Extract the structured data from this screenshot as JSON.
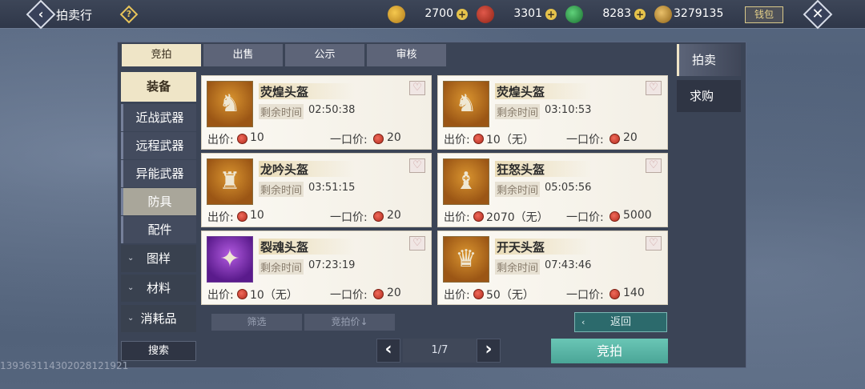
{
  "window": {
    "title": "拍卖行"
  },
  "topbar": {
    "back_icon": "‹",
    "help_icon": "?",
    "currencies": [
      {
        "name": "gold-ingot",
        "value": "2700",
        "color": "#e2a72f"
      },
      {
        "name": "red-coin",
        "value": "3301",
        "color": "#c2462e"
      },
      {
        "name": "jade-coin",
        "value": "8283",
        "color": "#2d9a47"
      },
      {
        "name": "silver-feather",
        "value": "3279135",
        "color": "#c89a3a"
      }
    ],
    "wallet_label": "钱包",
    "close_icon": "✕"
  },
  "tabs": [
    {
      "label": "竞拍",
      "active": true
    },
    {
      "label": "出售",
      "active": false
    },
    {
      "label": "公示",
      "active": false
    },
    {
      "label": "审核",
      "active": false
    }
  ],
  "categories": [
    {
      "label": "装备",
      "kind": "main-active"
    },
    {
      "label": "近战武器",
      "kind": "sub"
    },
    {
      "label": "远程武器",
      "kind": "sub"
    },
    {
      "label": "异能武器",
      "kind": "sub"
    },
    {
      "label": "防具",
      "kind": "sub-active"
    },
    {
      "label": "配件",
      "kind": "sub"
    },
    {
      "label": "图样",
      "kind": "group"
    },
    {
      "label": "材料",
      "kind": "group"
    },
    {
      "label": "消耗品",
      "kind": "group"
    }
  ],
  "listings": {
    "time_label": "剩余时间",
    "bid_label": "出价:",
    "buyout_label": "一口价:",
    "items": [
      {
        "name": "荧煌头盔",
        "time": "02:50:38",
        "bid": "10",
        "buyout": "20",
        "rarity": "orange",
        "icon": "horned-helmet-icon"
      },
      {
        "name": "荧煌头盔",
        "time": "03:10:53",
        "bid": "10（无）",
        "buyout": "20",
        "rarity": "orange",
        "icon": "horned-helmet-icon"
      },
      {
        "name": "龙吟头盔",
        "time": "03:51:15",
        "bid": "10",
        "buyout": "20",
        "rarity": "orange",
        "icon": "dragon-helmet-icon"
      },
      {
        "name": "狂怒头盔",
        "time": "05:05:56",
        "bid": "2070（无）",
        "buyout": "5000",
        "rarity": "orange",
        "icon": "fury-helmet-icon"
      },
      {
        "name": "裂魂头盔",
        "time": "07:23:19",
        "bid": "10（无）",
        "buyout": "20",
        "rarity": "purple",
        "icon": "spiked-helmet-icon"
      },
      {
        "name": "开天头盔",
        "time": "07:43:46",
        "bid": "50（无）",
        "buyout": "140",
        "rarity": "orange",
        "icon": "red-horned-helmet-icon"
      }
    ]
  },
  "filters": {
    "filter_label": "筛选",
    "sort_label": "竞拍价↓"
  },
  "return_label": "返回",
  "search_label": "搜索",
  "pager": {
    "label": "1/7",
    "prev": "‹",
    "next": "›"
  },
  "bid_button_label": "竞拍",
  "side_tabs": [
    {
      "label": "拍卖",
      "active": true
    },
    {
      "label": "求购",
      "active": false
    }
  ],
  "uid": "1393631143020281219​21"
}
